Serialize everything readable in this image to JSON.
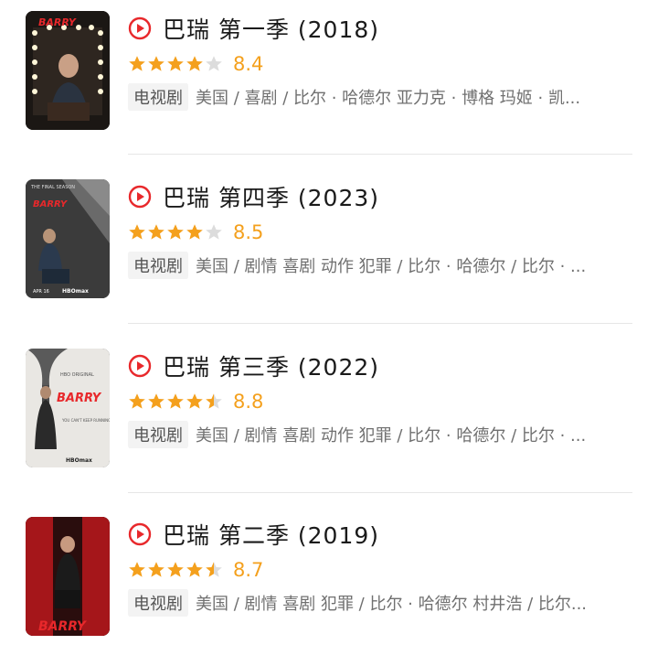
{
  "items": [
    {
      "title": "巴瑞 第一季 (2018)",
      "rating": 8.4,
      "rating_stars": 4.0,
      "score": "8.4",
      "tag": "电视剧",
      "meta": "美国 / 喜剧 / 比尔 · 哈德尔 亚力克 · 博格 玛姬 · 凯...",
      "poster_art": "barry-season-1-poster"
    },
    {
      "title": "巴瑞 第四季 (2023)",
      "rating": 8.5,
      "rating_stars": 4.0,
      "score": "8.5",
      "tag": "电视剧",
      "meta": "美国 / 剧情 喜剧 动作 犯罪 / 比尔 · 哈德尔 / 比尔 · ...",
      "poster_art": "barry-season-4-poster"
    },
    {
      "title": "巴瑞 第三季 (2022)",
      "rating": 8.8,
      "rating_stars": 4.5,
      "score": "8.8",
      "tag": "电视剧",
      "meta": "美国 / 剧情 喜剧 动作 犯罪 / 比尔 · 哈德尔 / 比尔 · ...",
      "poster_art": "barry-season-3-poster"
    },
    {
      "title": "巴瑞 第二季 (2019)",
      "rating": 8.7,
      "rating_stars": 4.5,
      "score": "8.7",
      "tag": "电视剧",
      "meta": "美国 / 剧情 喜剧 犯罪 / 比尔 · 哈德尔 村井浩 / 比尔...",
      "poster_art": "barry-season-2-poster"
    }
  ],
  "colors": {
    "accent_red": "#e8282b",
    "star_gold": "#f4a01d",
    "star_empty": "#dcdcdc"
  },
  "icons": {
    "play": "play-circle-icon",
    "star": "star-icon"
  }
}
